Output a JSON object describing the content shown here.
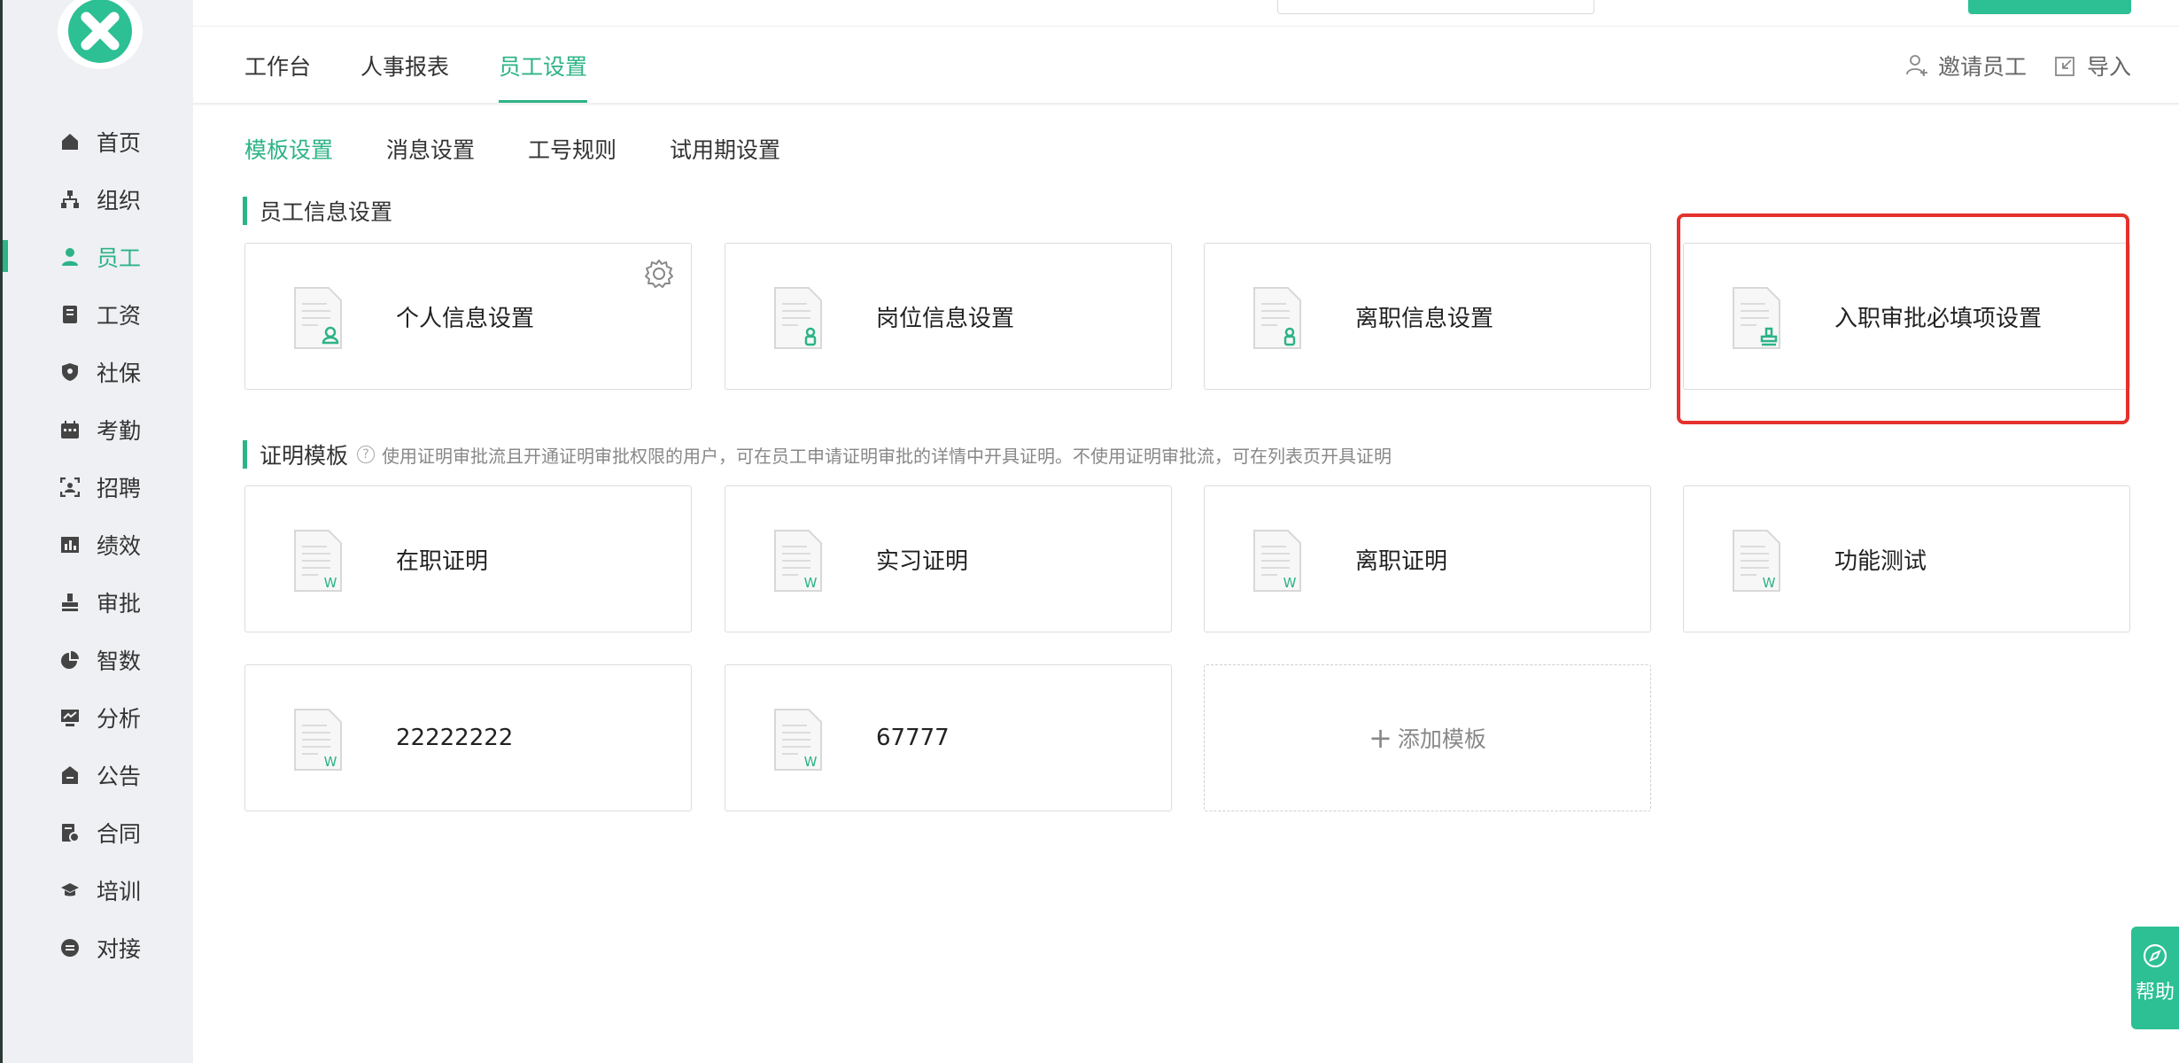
{
  "brand": {
    "accent": "#2cb387",
    "highlight": "#e5312d"
  },
  "sidebar": {
    "items": [
      {
        "label": "首页",
        "icon": "home-icon",
        "active": false
      },
      {
        "label": "组织",
        "icon": "org-tree-icon",
        "active": false
      },
      {
        "label": "员工",
        "icon": "user-icon",
        "active": true
      },
      {
        "label": "工资",
        "icon": "salary-icon",
        "active": false
      },
      {
        "label": "社保",
        "icon": "shield-icon",
        "active": false
      },
      {
        "label": "考勤",
        "icon": "calendar-icon",
        "active": false
      },
      {
        "label": "招聘",
        "icon": "recruit-scan-icon",
        "active": false
      },
      {
        "label": "绩效",
        "icon": "bar-chart-icon",
        "active": false
      },
      {
        "label": "审批",
        "icon": "stamp-icon",
        "active": false
      },
      {
        "label": "智数",
        "icon": "pie-chart-icon",
        "active": false
      },
      {
        "label": "分析",
        "icon": "monitor-chart-icon",
        "active": false
      },
      {
        "label": "公告",
        "icon": "briefcase-icon",
        "active": false
      },
      {
        "label": "合同",
        "icon": "contract-icon",
        "active": false
      },
      {
        "label": "培训",
        "icon": "graduation-cap-icon",
        "active": false
      },
      {
        "label": "对接",
        "icon": "link-icon",
        "active": false
      }
    ]
  },
  "header": {
    "tabs": [
      {
        "label": "工作台",
        "active": false
      },
      {
        "label": "人事报表",
        "active": false
      },
      {
        "label": "员工设置",
        "active": true
      }
    ],
    "actions": {
      "invite": "邀请员工",
      "import": "导入"
    }
  },
  "subtabs": [
    {
      "label": "模板设置",
      "active": true
    },
    {
      "label": "消息设置",
      "active": false
    },
    {
      "label": "工号规则",
      "active": false
    },
    {
      "label": "试用期设置",
      "active": false
    }
  ],
  "employee_info": {
    "title": "员工信息设置",
    "cards": [
      {
        "label": "个人信息设置",
        "icon": "doc-person-icon"
      },
      {
        "label": "岗位信息设置",
        "icon": "doc-badge-icon"
      },
      {
        "label": "离职信息设置",
        "icon": "doc-badge-icon"
      },
      {
        "label": "入职审批必填项设置",
        "icon": "doc-stamp-icon"
      }
    ]
  },
  "certificates": {
    "title": "证明模板",
    "hint": "使用证明审批流且开通证明审批权限的用户，可在员工申请证明审批的详情中开具证明。不使用证明审批流，可在列表页开具证明",
    "cards": [
      {
        "label": "在职证明"
      },
      {
        "label": "实习证明"
      },
      {
        "label": "离职证明"
      },
      {
        "label": "功能测试"
      },
      {
        "label": "22222222"
      },
      {
        "label": "67777"
      }
    ],
    "add_label": "添加模板"
  },
  "help": {
    "label": "帮助"
  }
}
